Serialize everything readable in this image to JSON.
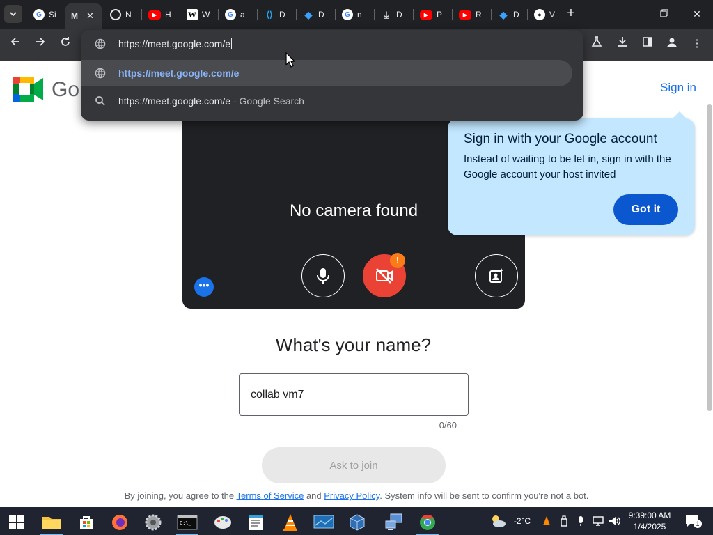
{
  "browser": {
    "tabs": [
      {
        "title": "Si",
        "favicon": "google-icon",
        "color": "#4285f4"
      },
      {
        "title": "M",
        "favicon": "meet-icon",
        "color": "#00832d",
        "active": true
      },
      {
        "title": "N",
        "favicon": "chrome-icon",
        "color": "#e8eaed"
      },
      {
        "title": "H",
        "favicon": "youtube-icon",
        "color": "#ff0000"
      },
      {
        "title": "W",
        "favicon": "wikipedia-icon",
        "color": "#ffffff"
      },
      {
        "title": "a",
        "favicon": "google-icon",
        "color": "#4285f4"
      },
      {
        "title": "D",
        "favicon": "vscode-icon",
        "color": "#23a9f2"
      },
      {
        "title": "D",
        "favicon": "dub-icon",
        "color": "#3ba1ff"
      },
      {
        "title": "n",
        "favicon": "google-icon",
        "color": "#4285f4"
      },
      {
        "title": "D",
        "favicon": "download-icon",
        "color": "#e8eaed"
      },
      {
        "title": "P",
        "favicon": "youtube-icon",
        "color": "#ff0000"
      },
      {
        "title": "R",
        "favicon": "youtube-icon",
        "color": "#ff0000"
      },
      {
        "title": "D",
        "favicon": "dub-icon",
        "color": "#3ba1ff"
      },
      {
        "title": "V",
        "favicon": "github-icon",
        "color": "#ffffff"
      }
    ],
    "omnibox": {
      "value": "https://meet.google.com/e",
      "suggestions": [
        {
          "text": "https://meet.google.com/e",
          "hint": "",
          "icon": "globe-icon"
        },
        {
          "text": "https://meet.google.com/e",
          "hint": " - Google Search",
          "icon": "search-icon"
        }
      ]
    }
  },
  "page": {
    "logo_text": "Go",
    "sign_in": "Sign in",
    "no_camera": "No camera found",
    "callout": {
      "title": "Sign in with your Google account",
      "body": "Instead of waiting to be let in, sign in with the Google account your host invited",
      "button": "Got it"
    },
    "warning_badge": "!",
    "heading": "What's your name?",
    "name_value": "collab vm7",
    "counter": "0/60",
    "ask_button": "Ask to join",
    "footer": {
      "prefix": "By joining, you agree to the ",
      "tos": "Terms of Service",
      "and": " and ",
      "privacy": "Privacy Policy",
      "suffix": ". System info will be sent to confirm you're not a bot."
    }
  },
  "taskbar": {
    "weather": "-2°C",
    "time": "9:39:00 AM",
    "date": "1/4/2025",
    "notifications": "1"
  },
  "colors": {
    "meet_blue": "#1a73e8",
    "mic_red": "#ea4335",
    "callout_bg": "#c2e7ff"
  }
}
